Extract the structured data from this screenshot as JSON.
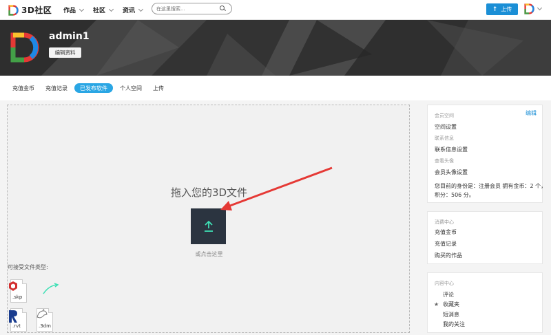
{
  "header": {
    "logo_text": "3D社区",
    "nav": [
      {
        "label": "作品"
      },
      {
        "label": "社区"
      },
      {
        "label": "资讯"
      }
    ],
    "search_placeholder": "在这里搜索...",
    "upload_label": "上传"
  },
  "profile": {
    "username": "admin1",
    "edit_label": "编辑资料"
  },
  "tabs": [
    {
      "label": "充值金币",
      "active": false
    },
    {
      "label": "充值记录",
      "active": false
    },
    {
      "label": "已发布软件",
      "active": true
    },
    {
      "label": "个人空间",
      "active": false
    },
    {
      "label": "上传",
      "active": false
    }
  ],
  "upload": {
    "title": "拖入您的3D文件",
    "subtitle": "或点击这里",
    "accepted_label": "可接受文件类型:",
    "file_types": [
      ".skp",
      ".rvt",
      ".3dm"
    ]
  },
  "sidebar": {
    "member": {
      "edit_label": "编辑",
      "section_title": "会员空间",
      "space_settings": "空间设置",
      "contact_title": "联系信息",
      "contact_settings": "联系信息设置",
      "avatar_title": "查看头像",
      "avatar_settings": "会员头像设置",
      "status_line1": "您目前的身份是：注册会员 拥有金币：2 个，",
      "status_line2": "积分：506 分。"
    },
    "consume": {
      "title": "消费中心",
      "items": [
        "充值金币",
        "充值记录",
        "购买的作品"
      ]
    },
    "content": {
      "title": "内容中心",
      "items": [
        "评论",
        "收藏夹",
        "短消息",
        "我的关注"
      ]
    }
  },
  "colors": {
    "accent": "#1b8fd6",
    "tab_active": "#2aa6e4",
    "upload_tile": "#2b3440",
    "upload_arrow": "#3fe0b5",
    "pointer": "#e53935"
  }
}
